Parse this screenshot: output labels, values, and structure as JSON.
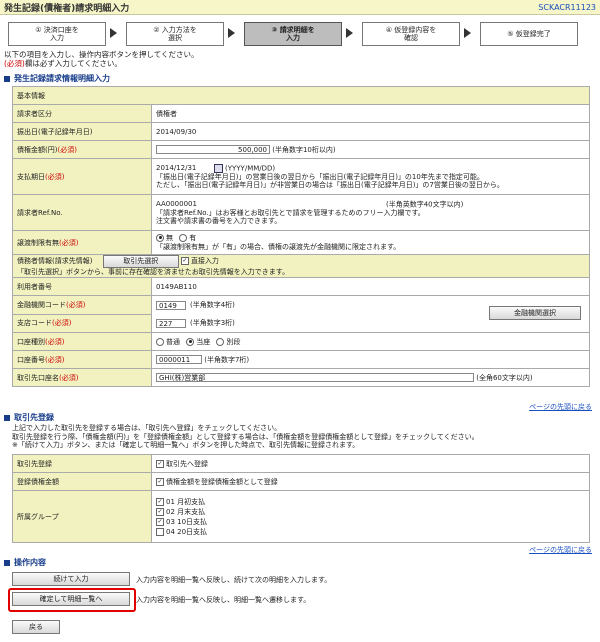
{
  "header": {
    "title": "発生記録(債権者)請求明細入力",
    "screen_code": "SCKACR11123"
  },
  "steps": [
    {
      "num": "①",
      "line1": "決済口座を",
      "line2": "入力"
    },
    {
      "num": "②",
      "line1": "入力方法を",
      "line2": "選択"
    },
    {
      "num": "③",
      "line1": "請求明細を",
      "line2": "入力"
    },
    {
      "num": "④",
      "line1": "仮登録内容を",
      "line2": "確認"
    },
    {
      "num": "⑤",
      "line1": "仮登録完了",
      "line2": ""
    }
  ],
  "intro": {
    "line1": "以下の項目を入力し、操作内容ボタンを押してください。",
    "req_mark": "(必須)",
    "line2": "欄は必ず入力してください。"
  },
  "section1": {
    "title": "発生記録請求情報明細入力",
    "basic_info": "基本情報",
    "req_label": "(必須)",
    "claimant_type": {
      "label": "請求者区分",
      "value": "債権者"
    },
    "issue_date": {
      "label": "振出日(電子記録年月日)",
      "value": "2014/09/30"
    },
    "amount": {
      "label": "債権金額(円)",
      "value": "500,000",
      "hint": "(半角数字10桁以内)"
    },
    "payment_date": {
      "label": "支払期日",
      "value": "2014/12/31",
      "format": "(YYYY/MM/DD)",
      "note1": "「振出日(電子記録年月日)」の営業日後の翌日から「振出日(電子記録年月日)」の10年先まで指定可能。",
      "note2": "ただし、「振出日(電子記録年月日)」が非営業日の場合は「振出日(電子記録年月日)」の7営業日後の翌日から。"
    },
    "ref_no": {
      "label": "請求者Ref.No.",
      "value": "AA0000001",
      "hint": "(半角英数字40文字以内)",
      "note1": "「請求者Ref.No.」はお客様とお取引先とで請求を管理するためのフリー入力欄です。",
      "note2": "注文書や請求書の番号を入力できます。"
    },
    "transfer_limit": {
      "label": "譲渡制限有無",
      "opt_none": "無",
      "opt_yes": "有",
      "note": "「譲渡制限有無」が「有」の場合、債権の譲渡先が金融機関に限定されます。"
    },
    "debtor_info": {
      "label": "債務者情報(請求先情報)",
      "select_btn": "取引先選択",
      "direct_input": "直接入力",
      "note": "「取引先選択」ボタンから、事前に存在確認を済ませたお取引先情報を入力できます。"
    },
    "user_no": {
      "label": "利用者番号",
      "value": "0149AB110"
    },
    "bank_code": {
      "label": "金融機関コード",
      "value": "0149",
      "hint": "(半角数字4桁)",
      "select_btn": "金融機関選択"
    },
    "branch_code": {
      "label": "支店コード",
      "value": "227",
      "hint": "(半角数字3桁)"
    },
    "account_type": {
      "label": "口座種別",
      "opt1": "普通",
      "opt2": "当座",
      "opt3": "別段"
    },
    "account_no": {
      "label": "口座番号",
      "value": "0000011",
      "hint": "(半角数字7桁)"
    },
    "account_name": {
      "label": "取引先口座名",
      "value": "GHI(株)営業部",
      "hint": "(全角60文字以内)"
    }
  },
  "page_top": "ページの先頭に戻る",
  "section2": {
    "title": "取引先登録",
    "note1": "上記で入力した取引先を登録する場合は、「取引先へ登録」をチェックしてください。",
    "note2": "取引先登録を行う際、「債権金額(円)」を「登録債権金額」として登録する場合は、「債権金額を登録債権金額として登録」をチェックしてください。",
    "note3": "※「続けて入力」ボタン、または「確定して明細一覧へ」ボタンを押した時点で、取引先情報に登録されます。",
    "register": {
      "label": "取引先登録",
      "option": "取引先へ登録"
    },
    "reg_amount": {
      "label": "登録債権金額",
      "option": "債権金額を登録債権金額として登録"
    },
    "group": {
      "label": "所属グループ",
      "items": [
        "01 月初支払",
        "02 月末支払",
        "03 10日支払",
        "04 20日支払"
      ]
    }
  },
  "section3": {
    "title": "操作内容",
    "continue_btn": "続けて入力",
    "continue_desc": "入力内容を明細一覧へ反映し、続けて次の明細を入力します。",
    "confirm_btn": "確定して明細一覧へ",
    "confirm_desc": "入力内容を明細一覧へ反映し、明細一覧へ遷移します。",
    "back_btn": "戻る"
  },
  "colors": {
    "accent": "#173d8a",
    "label_bg": "#f2f2c0",
    "highlight": "#e00000"
  }
}
